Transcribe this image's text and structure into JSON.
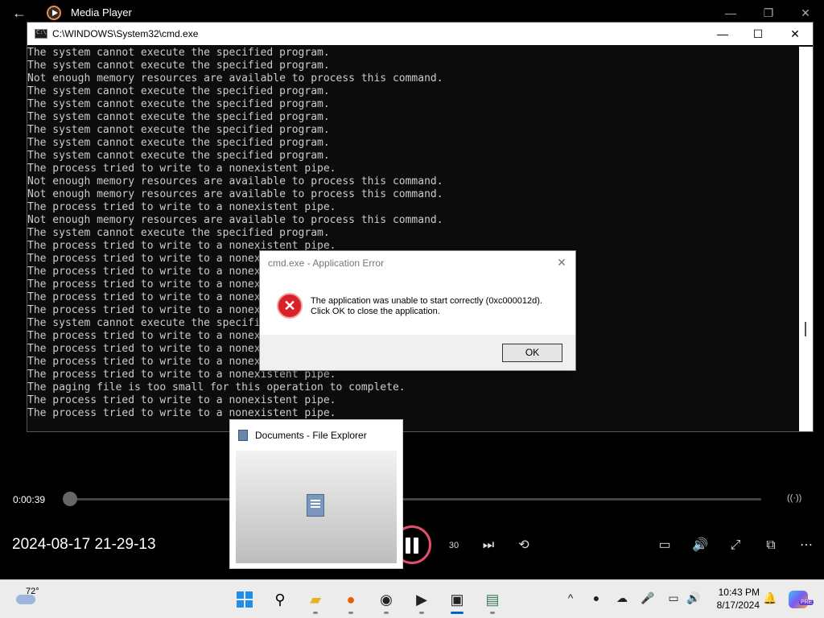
{
  "media_player": {
    "title": "Media Player",
    "current_time": "0:00:39",
    "video_title": "2024-08-17 21-29-13",
    "progress_fraction": 0.0,
    "skip_forward_label": "30"
  },
  "cmd": {
    "title": "C:\\WINDOWS\\System32\\cmd.exe",
    "lines": [
      "The system cannot execute the specified program.",
      "The system cannot execute the specified program.",
      "Not enough memory resources are available to process this command.",
      "The system cannot execute the specified program.",
      "The system cannot execute the specified program.",
      "The system cannot execute the specified program.",
      "The system cannot execute the specified program.",
      "The system cannot execute the specified program.",
      "The system cannot execute the specified program.",
      "The process tried to write to a nonexistent pipe.",
      "Not enough memory resources are available to process this command.",
      "Not enough memory resources are available to process this command.",
      "The process tried to write to a nonexistent pipe.",
      "Not enough memory resources are available to process this command.",
      "The system cannot execute the specified program.",
      "The process tried to write to a nonexistent pipe.",
      "The process tried to write to a nonexistent pipe.",
      "The process tried to write to a nonexistent pipe.",
      "The process tried to write to a nonexistent pipe.",
      "The process tried to write to a nonexistent pipe.",
      "The process tried to write to a nonexistent pipe.",
      "The system cannot execute the specified program.",
      "The process tried to write to a nonexistent pipe.",
      "The process tried to write to a nonexistent pipe.",
      "The process tried to write to a nonexistent pipe.",
      "The process tried to write to a nonexistent pipe.",
      "The paging file is too small for this operation to complete.",
      "The process tried to write to a nonexistent pipe.",
      "The process tried to write to a nonexistent pipe."
    ]
  },
  "error_dialog": {
    "title": "cmd.exe - Application Error",
    "message_line1": "The application was unable to start correctly (0xc000012d).",
    "message_line2": "Click OK to close the application.",
    "ok_label": "OK"
  },
  "explorer_preview": {
    "title": "Documents - File Explorer"
  },
  "taskbar": {
    "weather_temp": "72°",
    "clock_time": "10:43 PM",
    "clock_date": "8/17/2024",
    "copilot_badge": "PRE",
    "apps": [
      "start",
      "search",
      "file-explorer",
      "firefox",
      "obs",
      "media-player",
      "cmd",
      "notepad"
    ]
  },
  "colors": {
    "console_bg": "#0c0c0c",
    "console_text": "#cccccc",
    "error_red": "#d8202a",
    "accent_blue": "#0067c0"
  }
}
